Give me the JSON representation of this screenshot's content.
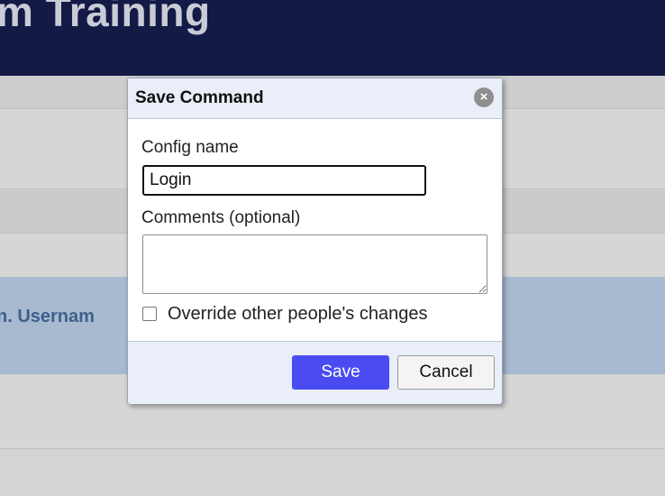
{
  "page": {
    "header_title": "m Training",
    "highlighted_row_text": "n. Usernam"
  },
  "dialog": {
    "title": "Save Command",
    "close_icon": "close-icon",
    "config_name_label": "Config name",
    "config_name_value": "Login",
    "comments_label": "Comments (optional)",
    "comments_value": "",
    "override_label": "Override other people's changes",
    "override_checked": false,
    "save_label": "Save",
    "cancel_label": "Cancel"
  },
  "colors": {
    "header_bg": "#131a45",
    "highlight_row": "#a7bad0",
    "save_button": "#4a4cf2"
  }
}
